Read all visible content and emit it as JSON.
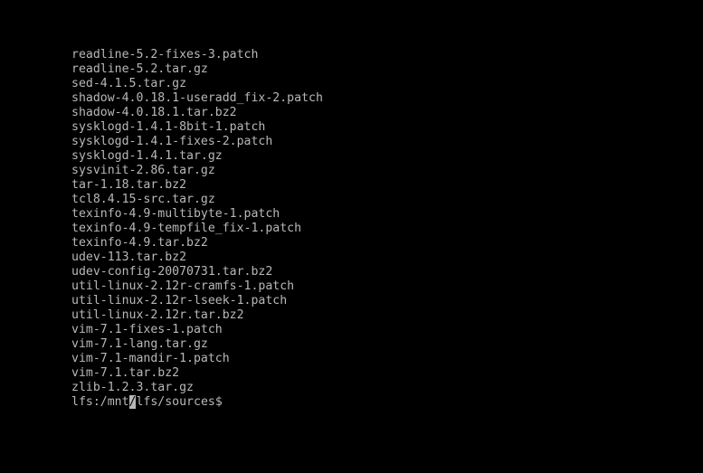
{
  "terminal": {
    "lines": [
      "readline-5.2-fixes-3.patch",
      "readline-5.2.tar.gz",
      "sed-4.1.5.tar.gz",
      "shadow-4.0.18.1-useradd_fix-2.patch",
      "shadow-4.0.18.1.tar.bz2",
      "sysklogd-1.4.1-8bit-1.patch",
      "sysklogd-1.4.1-fixes-2.patch",
      "sysklogd-1.4.1.tar.gz",
      "sysvinit-2.86.tar.gz",
      "tar-1.18.tar.bz2",
      "tcl8.4.15-src.tar.gz",
      "texinfo-4.9-multibyte-1.patch",
      "texinfo-4.9-tempfile_fix-1.patch",
      "texinfo-4.9.tar.bz2",
      "udev-113.tar.bz2",
      "udev-config-20070731.tar.bz2",
      "util-linux-2.12r-cramfs-1.patch",
      "util-linux-2.12r-lseek-1.patch",
      "util-linux-2.12r.tar.bz2",
      "vim-7.1-fixes-1.patch",
      "vim-7.1-lang.tar.gz",
      "vim-7.1-mandir-1.patch",
      "vim-7.1.tar.bz2",
      "zlib-1.2.3.tar.gz"
    ],
    "prompt": {
      "before_cursor": "lfs:/mnt",
      "cursor_char": "/",
      "after_cursor": "lfs/sources$"
    },
    "colors": {
      "background": "#000000",
      "foreground": "#b8b8b8"
    }
  }
}
